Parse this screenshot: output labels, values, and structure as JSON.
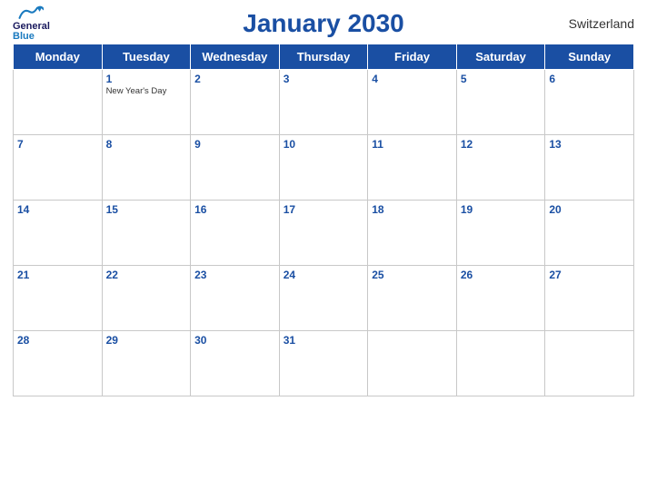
{
  "header": {
    "title": "January 2030",
    "country": "Switzerland",
    "logo": {
      "line1": "General",
      "line2": "Blue"
    }
  },
  "days_of_week": [
    "Monday",
    "Tuesday",
    "Wednesday",
    "Thursday",
    "Friday",
    "Saturday",
    "Sunday"
  ],
  "weeks": [
    [
      {
        "date": "",
        "holiday": ""
      },
      {
        "date": "1",
        "holiday": "New Year's Day"
      },
      {
        "date": "2",
        "holiday": ""
      },
      {
        "date": "3",
        "holiday": ""
      },
      {
        "date": "4",
        "holiday": ""
      },
      {
        "date": "5",
        "holiday": ""
      },
      {
        "date": "6",
        "holiday": ""
      }
    ],
    [
      {
        "date": "7",
        "holiday": ""
      },
      {
        "date": "8",
        "holiday": ""
      },
      {
        "date": "9",
        "holiday": ""
      },
      {
        "date": "10",
        "holiday": ""
      },
      {
        "date": "11",
        "holiday": ""
      },
      {
        "date": "12",
        "holiday": ""
      },
      {
        "date": "13",
        "holiday": ""
      }
    ],
    [
      {
        "date": "14",
        "holiday": ""
      },
      {
        "date": "15",
        "holiday": ""
      },
      {
        "date": "16",
        "holiday": ""
      },
      {
        "date": "17",
        "holiday": ""
      },
      {
        "date": "18",
        "holiday": ""
      },
      {
        "date": "19",
        "holiday": ""
      },
      {
        "date": "20",
        "holiday": ""
      }
    ],
    [
      {
        "date": "21",
        "holiday": ""
      },
      {
        "date": "22",
        "holiday": ""
      },
      {
        "date": "23",
        "holiday": ""
      },
      {
        "date": "24",
        "holiday": ""
      },
      {
        "date": "25",
        "holiday": ""
      },
      {
        "date": "26",
        "holiday": ""
      },
      {
        "date": "27",
        "holiday": ""
      }
    ],
    [
      {
        "date": "28",
        "holiday": ""
      },
      {
        "date": "29",
        "holiday": ""
      },
      {
        "date": "30",
        "holiday": ""
      },
      {
        "date": "31",
        "holiday": ""
      },
      {
        "date": "",
        "holiday": ""
      },
      {
        "date": "",
        "holiday": ""
      },
      {
        "date": "",
        "holiday": ""
      }
    ]
  ],
  "colors": {
    "header_bg": "#1a4fa3",
    "title": "#1a4fa3",
    "day_number": "#1a4fa3"
  }
}
